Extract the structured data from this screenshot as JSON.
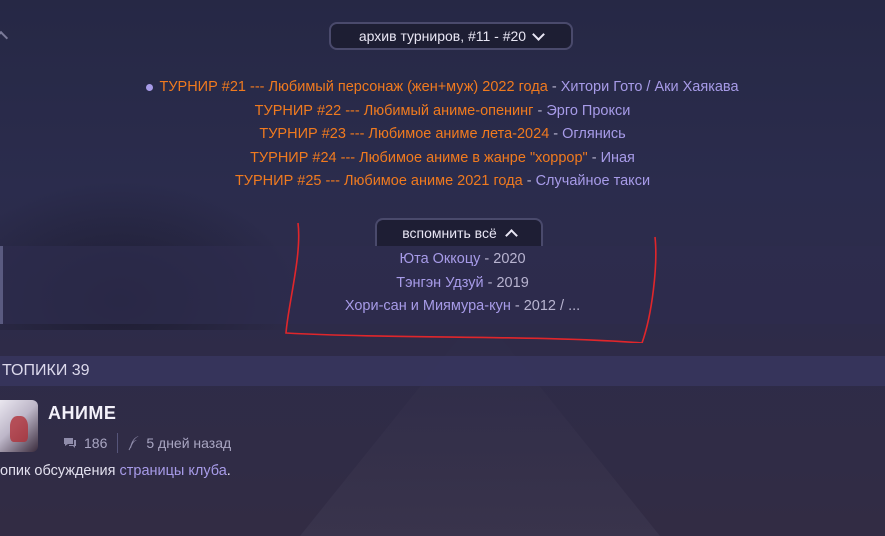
{
  "archive": {
    "label": "архив турниров, #11 - #20"
  },
  "tournaments": [
    {
      "name": "ТУРНИР #21 --- Любимый персонаж (жен+муж) 2022 года",
      "sep": " - ",
      "winner": "Хитори Гото / Аки Хаякава",
      "current": true
    },
    {
      "name": "ТУРНИР #22 --- Любимый аниме-опенинг",
      "sep": " - ",
      "winner": "Эрго Прокси",
      "current": false
    },
    {
      "name": "ТУРНИР #23 --- Любимое аниме лета-2024",
      "sep": " - ",
      "winner": "Оглянись",
      "current": false
    },
    {
      "name": "ТУРНИР #24 --- Любимое аниме в жанре \"хоррор\"",
      "sep": " - ",
      "winner": "Иная",
      "current": false
    },
    {
      "name": "ТУРНИР #25 --- Любимое аниме 2021 года",
      "sep": " - ",
      "winner": "Случайное такси",
      "current": false
    }
  ],
  "remember": {
    "label": "вспомнить всё",
    "items": [
      {
        "name": "Юта Оккоцу",
        "year": " - 2020"
      },
      {
        "name": "Тэнгэн Удзуй",
        "year": " - 2019"
      },
      {
        "name": "Хори-сан и Миямура-кун",
        "year": " - 2012 / ..."
      }
    ]
  },
  "topics": {
    "header": "ТОПИКИ 39",
    "item": {
      "title": "АНИМЕ",
      "comments": "186",
      "time": "5 дней назад",
      "desc_prefix": "опик обсуждения ",
      "desc_link": "страницы клуба",
      "desc_suffix": "."
    }
  },
  "colors": {
    "accent_orange": "#f07a1f",
    "accent_violet": "#a79be8",
    "annotation_red": "#e0262b"
  }
}
